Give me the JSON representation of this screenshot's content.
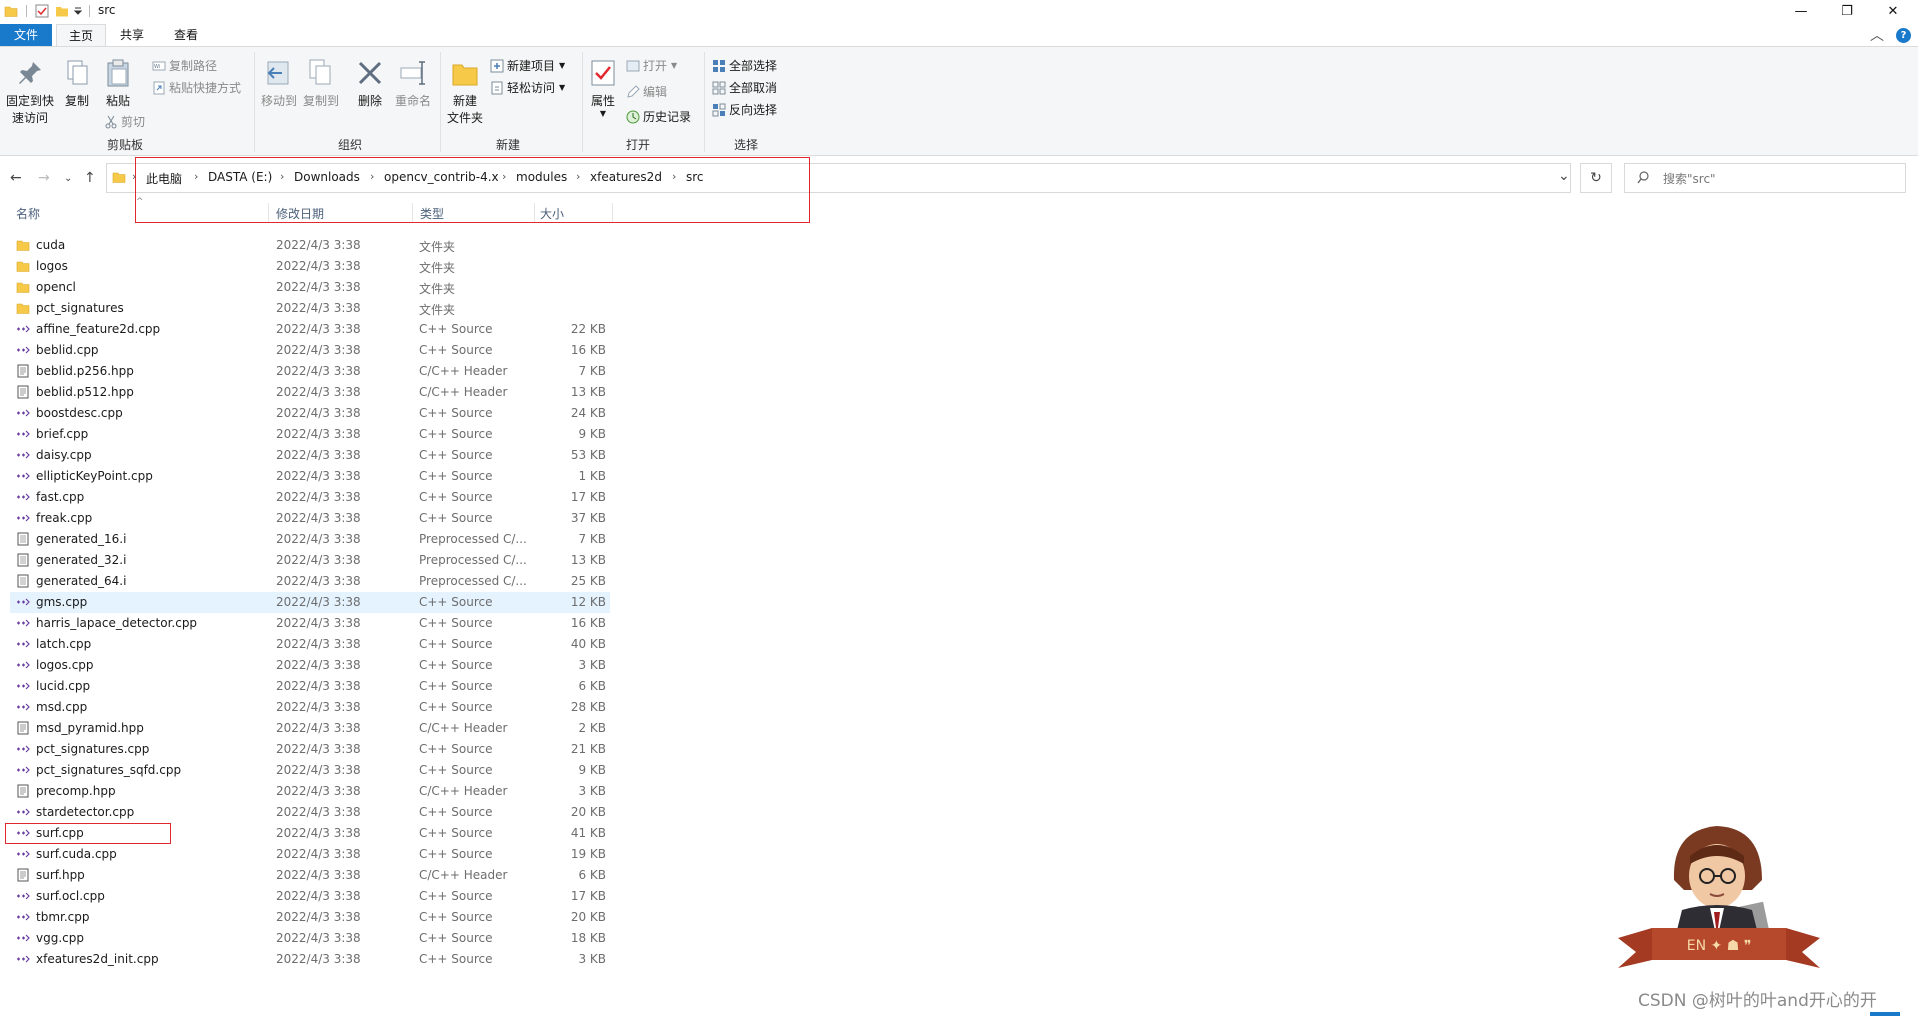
{
  "window": {
    "title": "src",
    "minimize_glyph": "—",
    "maximize_glyph": "❐",
    "close_glyph": "✕",
    "collapse_glyph": "︿",
    "help_glyph": "?"
  },
  "tabs": [
    {
      "label": "文件"
    },
    {
      "label": "主页"
    },
    {
      "label": "共享"
    },
    {
      "label": "查看"
    }
  ],
  "ribbon": {
    "pin_label_1": "固定到快",
    "pin_label_2": "速访问",
    "copy_label": "复制",
    "paste_label": "粘贴",
    "copy_path_label": "复制路径",
    "paste_shortcut_label": "粘贴快捷方式",
    "cut_label": "剪切",
    "clipboard_group": "剪贴板",
    "move_to_label": "移动到",
    "copy_to_label": "复制到",
    "delete_label": "删除",
    "rename_label": "重命名",
    "organize_group": "组织",
    "new_folder_label_1": "新建",
    "new_folder_label_2": "文件夹",
    "new_item_label": "新建项目",
    "easy_access_label": "轻松访问",
    "new_group": "新建",
    "properties_label": "属性",
    "open_label": "打开",
    "edit_label": "编辑",
    "history_label": "历史记录",
    "open_group": "打开",
    "select_all_label": "全部选择",
    "select_none_label": "全部取消",
    "invert_selection_label": "反向选择",
    "select_group": "选择"
  },
  "address": {
    "crumbs": [
      "此电脑",
      "DASTA (E:)",
      "Downloads",
      "opencv_contrib-4.x",
      "modules",
      "xfeatures2d",
      "src"
    ],
    "refresh_glyph": "↻",
    "dropdown_glyph": "⌄"
  },
  "search": {
    "placeholder": "搜索\"src\""
  },
  "columns": {
    "name": "名称",
    "date": "修改日期",
    "type": "类型",
    "size": "大小"
  },
  "files": [
    {
      "name": "cuda",
      "date": "2022/4/3 3:38",
      "type": "文件夹",
      "size": "",
      "icon": "folder-icon"
    },
    {
      "name": "logos",
      "date": "2022/4/3 3:38",
      "type": "文件夹",
      "size": "",
      "icon": "folder-icon"
    },
    {
      "name": "opencl",
      "date": "2022/4/3 3:38",
      "type": "文件夹",
      "size": "",
      "icon": "folder-icon"
    },
    {
      "name": "pct_signatures",
      "date": "2022/4/3 3:38",
      "type": "文件夹",
      "size": "",
      "icon": "folder-icon"
    },
    {
      "name": "affine_feature2d.cpp",
      "date": "2022/4/3 3:38",
      "type": "C++ Source",
      "size": "22 KB",
      "icon": "cpp-source-icon"
    },
    {
      "name": "beblid.cpp",
      "date": "2022/4/3 3:38",
      "type": "C++ Source",
      "size": "16 KB",
      "icon": "cpp-source-icon"
    },
    {
      "name": "beblid.p256.hpp",
      "date": "2022/4/3 3:38",
      "type": "C/C++ Header",
      "size": "7 KB",
      "icon": "header-file-icon"
    },
    {
      "name": "beblid.p512.hpp",
      "date": "2022/4/3 3:38",
      "type": "C/C++ Header",
      "size": "13 KB",
      "icon": "header-file-icon"
    },
    {
      "name": "boostdesc.cpp",
      "date": "2022/4/3 3:38",
      "type": "C++ Source",
      "size": "24 KB",
      "icon": "cpp-source-icon"
    },
    {
      "name": "brief.cpp",
      "date": "2022/4/3 3:38",
      "type": "C++ Source",
      "size": "9 KB",
      "icon": "cpp-source-icon"
    },
    {
      "name": "daisy.cpp",
      "date": "2022/4/3 3:38",
      "type": "C++ Source",
      "size": "53 KB",
      "icon": "cpp-source-icon"
    },
    {
      "name": "ellipticKeyPoint.cpp",
      "date": "2022/4/3 3:38",
      "type": "C++ Source",
      "size": "1 KB",
      "icon": "cpp-source-icon"
    },
    {
      "name": "fast.cpp",
      "date": "2022/4/3 3:38",
      "type": "C++ Source",
      "size": "17 KB",
      "icon": "cpp-source-icon"
    },
    {
      "name": "freak.cpp",
      "date": "2022/4/3 3:38",
      "type": "C++ Source",
      "size": "37 KB",
      "icon": "cpp-source-icon"
    },
    {
      "name": "generated_16.i",
      "date": "2022/4/3 3:38",
      "type": "Preprocessed C/...",
      "size": "7 KB",
      "icon": "text-file-icon"
    },
    {
      "name": "generated_32.i",
      "date": "2022/4/3 3:38",
      "type": "Preprocessed C/...",
      "size": "13 KB",
      "icon": "text-file-icon"
    },
    {
      "name": "generated_64.i",
      "date": "2022/4/3 3:38",
      "type": "Preprocessed C/...",
      "size": "25 KB",
      "icon": "text-file-icon"
    },
    {
      "name": "gms.cpp",
      "date": "2022/4/3 3:38",
      "type": "C++ Source",
      "size": "12 KB",
      "icon": "cpp-source-icon",
      "selected": true
    },
    {
      "name": "harris_lapace_detector.cpp",
      "date": "2022/4/3 3:38",
      "type": "C++ Source",
      "size": "16 KB",
      "icon": "cpp-source-icon"
    },
    {
      "name": "latch.cpp",
      "date": "2022/4/3 3:38",
      "type": "C++ Source",
      "size": "40 KB",
      "icon": "cpp-source-icon"
    },
    {
      "name": "logos.cpp",
      "date": "2022/4/3 3:38",
      "type": "C++ Source",
      "size": "3 KB",
      "icon": "cpp-source-icon"
    },
    {
      "name": "lucid.cpp",
      "date": "2022/4/3 3:38",
      "type": "C++ Source",
      "size": "6 KB",
      "icon": "cpp-source-icon"
    },
    {
      "name": "msd.cpp",
      "date": "2022/4/3 3:38",
      "type": "C++ Source",
      "size": "28 KB",
      "icon": "cpp-source-icon"
    },
    {
      "name": "msd_pyramid.hpp",
      "date": "2022/4/3 3:38",
      "type": "C/C++ Header",
      "size": "2 KB",
      "icon": "header-file-icon"
    },
    {
      "name": "pct_signatures.cpp",
      "date": "2022/4/3 3:38",
      "type": "C++ Source",
      "size": "21 KB",
      "icon": "cpp-source-icon"
    },
    {
      "name": "pct_signatures_sqfd.cpp",
      "date": "2022/4/3 3:38",
      "type": "C++ Source",
      "size": "9 KB",
      "icon": "cpp-source-icon"
    },
    {
      "name": "precomp.hpp",
      "date": "2022/4/3 3:38",
      "type": "C/C++ Header",
      "size": "3 KB",
      "icon": "header-file-icon"
    },
    {
      "name": "stardetector.cpp",
      "date": "2022/4/3 3:38",
      "type": "C++ Source",
      "size": "20 KB",
      "icon": "cpp-source-icon"
    },
    {
      "name": "surf.cpp",
      "date": "2022/4/3 3:38",
      "type": "C++ Source",
      "size": "41 KB",
      "icon": "cpp-source-icon"
    },
    {
      "name": "surf.cuda.cpp",
      "date": "2022/4/3 3:38",
      "type": "C++ Source",
      "size": "19 KB",
      "icon": "cpp-source-icon"
    },
    {
      "name": "surf.hpp",
      "date": "2022/4/3 3:38",
      "type": "C/C++ Header",
      "size": "6 KB",
      "icon": "header-file-icon"
    },
    {
      "name": "surf.ocl.cpp",
      "date": "2022/4/3 3:38",
      "type": "C++ Source",
      "size": "17 KB",
      "icon": "cpp-source-icon"
    },
    {
      "name": "tbmr.cpp",
      "date": "2022/4/3 3:38",
      "type": "C++ Source",
      "size": "20 KB",
      "icon": "cpp-source-icon"
    },
    {
      "name": "vgg.cpp",
      "date": "2022/4/3 3:38",
      "type": "C++ Source",
      "size": "18 KB",
      "icon": "cpp-source-icon"
    },
    {
      "name": "xfeatures2d_init.cpp",
      "date": "2022/4/3 3:38",
      "type": "C++ Source",
      "size": "3 KB",
      "icon": "cpp-source-icon"
    }
  ],
  "watermark": "CSDN @树叶的叶and开心的开",
  "mascot_badge": "EN ✦ ☗ ❞",
  "colors": {
    "accent": "#1979ca",
    "selection": "#e5f3ff",
    "annotation_red": "#e0282e",
    "folder": "#f7c948"
  }
}
